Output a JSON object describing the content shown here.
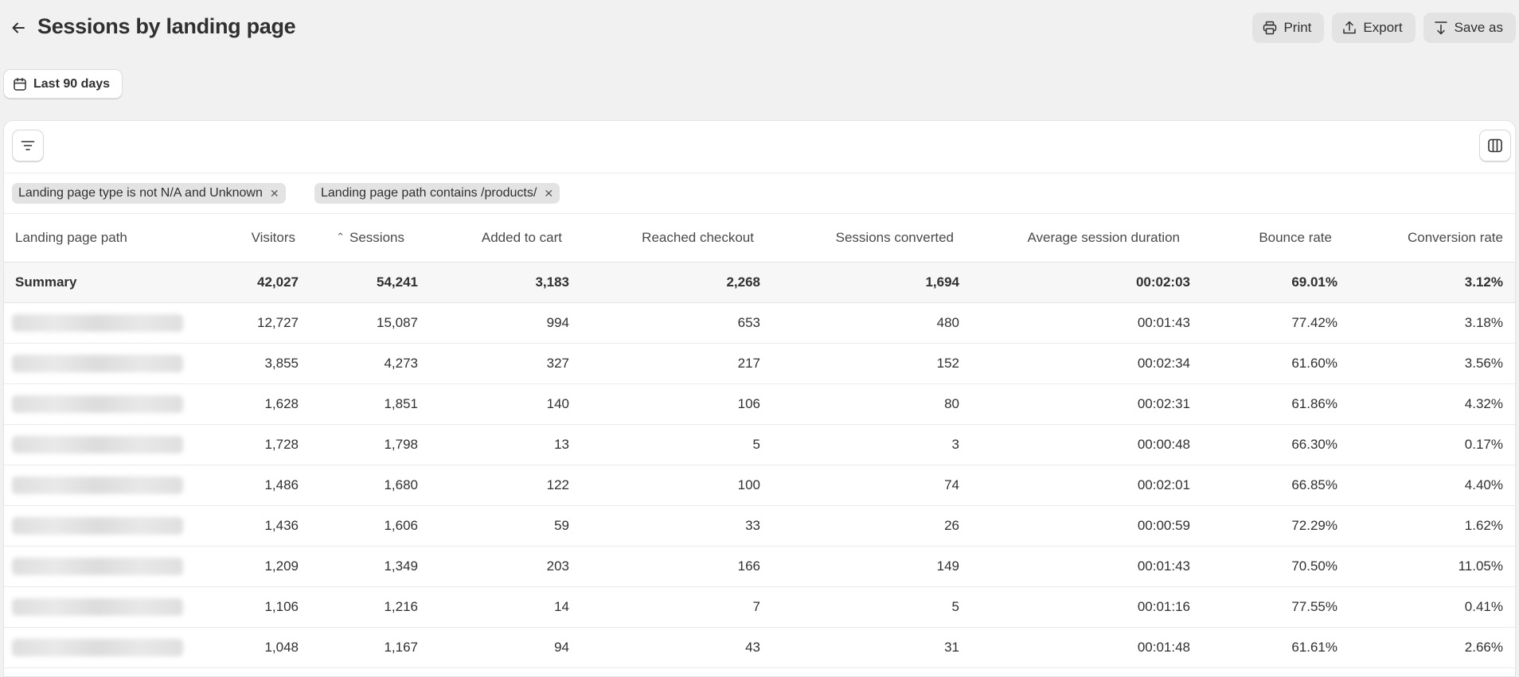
{
  "header": {
    "title": "Sessions by landing page",
    "actions": [
      {
        "label": "Print",
        "icon": "printer-icon"
      },
      {
        "label": "Export",
        "icon": "upload-icon"
      },
      {
        "label": "Save as",
        "icon": "download-icon"
      }
    ]
  },
  "date_range": {
    "label": "Last 90 days",
    "icon": "calendar-icon"
  },
  "filters": [
    {
      "label": "Landing page type is not N/A and Unknown"
    },
    {
      "label": "Landing page path contains /products/"
    }
  ],
  "table": {
    "sorted_column": "Sessions",
    "columns": [
      "Landing page path",
      "Visitors",
      "Sessions",
      "Added to cart",
      "Reached checkout",
      "Sessions converted",
      "Average session duration",
      "Bounce rate",
      "Conversion rate"
    ],
    "summary": [
      "Summary",
      "42,027",
      "54,241",
      "3,183",
      "2,268",
      "1,694",
      "00:02:03",
      "69.01%",
      "3.12%"
    ],
    "rows": [
      [
        "",
        "12,727",
        "15,087",
        "994",
        "653",
        "480",
        "00:01:43",
        "77.42%",
        "3.18%"
      ],
      [
        "",
        "3,855",
        "4,273",
        "327",
        "217",
        "152",
        "00:02:34",
        "61.60%",
        "3.56%"
      ],
      [
        "",
        "1,628",
        "1,851",
        "140",
        "106",
        "80",
        "00:02:31",
        "61.86%",
        "4.32%"
      ],
      [
        "",
        "1,728",
        "1,798",
        "13",
        "5",
        "3",
        "00:00:48",
        "66.30%",
        "0.17%"
      ],
      [
        "",
        "1,486",
        "1,680",
        "122",
        "100",
        "74",
        "00:02:01",
        "66.85%",
        "4.40%"
      ],
      [
        "",
        "1,436",
        "1,606",
        "59",
        "33",
        "26",
        "00:00:59",
        "72.29%",
        "1.62%"
      ],
      [
        "",
        "1,209",
        "1,349",
        "203",
        "166",
        "149",
        "00:01:43",
        "70.50%",
        "11.05%"
      ],
      [
        "",
        "1,106",
        "1,216",
        "14",
        "7",
        "5",
        "00:01:16",
        "77.55%",
        "0.41%"
      ],
      [
        "",
        "1,048",
        "1,167",
        "94",
        "43",
        "31",
        "00:01:48",
        "61.61%",
        "2.66%"
      ]
    ]
  }
}
